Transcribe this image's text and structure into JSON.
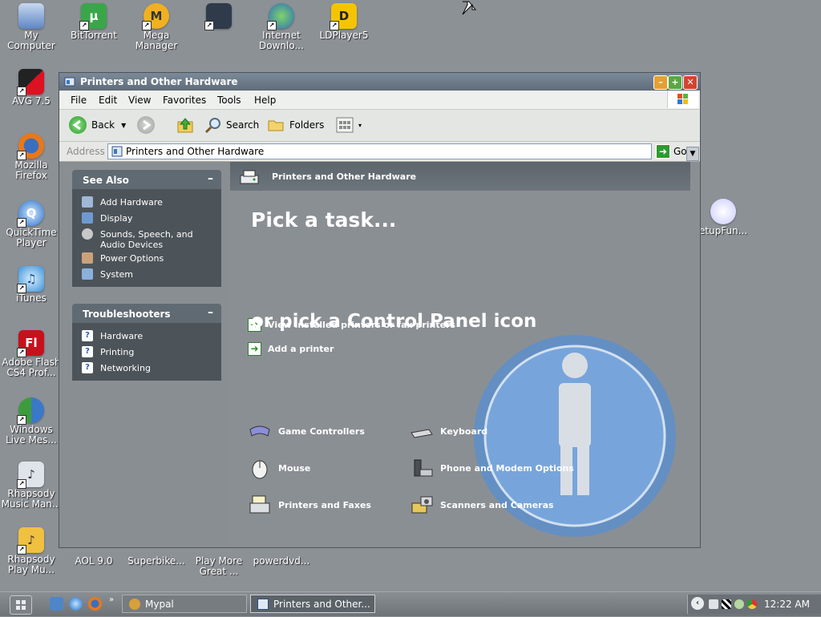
{
  "desktop": {
    "icons": [
      {
        "label": "My\nComputer"
      },
      {
        "label": "BitTorrent"
      },
      {
        "label": "Mega\nManager"
      },
      {
        "label": "Internet\nDownlo..."
      },
      {
        "label": "LDPlayer5"
      },
      {
        "label": "AVG 7.5"
      },
      {
        "label": "Mozilla\nFirefox"
      },
      {
        "label": "QuickTime\nPlayer"
      },
      {
        "label": "iTunes"
      },
      {
        "label": "Adobe Flash\nCS4 Prof..."
      },
      {
        "label": "Windows\nLive Mes..."
      },
      {
        "label": "Rhapsody\nMusic Man..."
      },
      {
        "label": "Rhapsody\nPlay Mu..."
      },
      {
        "label": "AOL 9.0"
      },
      {
        "label": "Superbike..."
      },
      {
        "label": "Play More\nGreat ..."
      },
      {
        "label": "powerdvd..."
      },
      {
        "label": "etupFun..."
      }
    ]
  },
  "window": {
    "title": "Printers and Other Hardware",
    "menu": [
      "File",
      "Edit",
      "View",
      "Favorites",
      "Tools",
      "Help"
    ],
    "toolbar": {
      "back": "Back",
      "search": "Search",
      "folders": "Folders"
    },
    "address": {
      "label": "Address",
      "value": "Printers and Other Hardware",
      "go": "Go"
    },
    "see_also": {
      "title": "See Also",
      "items": [
        "Add Hardware",
        "Display",
        "Sounds, Speech, and\nAudio Devices",
        "Power Options",
        "System"
      ]
    },
    "troubleshooters": {
      "title": "Troubleshooters",
      "items": [
        "Hardware",
        "Printing",
        "Networking"
      ]
    },
    "content": {
      "header": "Printers and Other Hardware",
      "pick_task": "Pick a task...",
      "tasks": [
        "View installed printers or fax printers",
        "Add a printer"
      ],
      "pick_icon": "or pick a Control Panel icon",
      "icons": [
        "Game Controllers",
        "Keyboard",
        "Mouse",
        "Phone and Modem Options",
        "Printers and Faxes",
        "Scanners and Cameras"
      ]
    }
  },
  "taskbar": {
    "buttons": [
      "Mypal",
      "Printers and Other..."
    ],
    "clock": "12:22 AM"
  }
}
